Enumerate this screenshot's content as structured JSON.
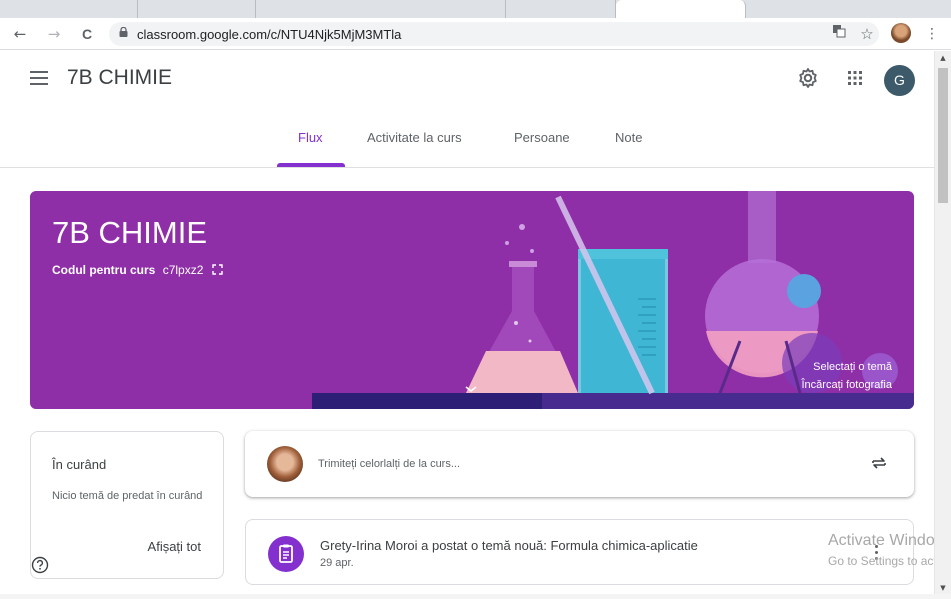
{
  "browser": {
    "url": "classroom.google.com/c/NTU4Njk5MjM3MTla",
    "nav": {
      "back": "←",
      "forward": "→",
      "reload": "C"
    }
  },
  "header": {
    "class_name": "7B CHIMIE",
    "avatar_letter": "G",
    "tabs": [
      {
        "label": "Flux"
      },
      {
        "label": "Activitate la curs"
      },
      {
        "label": "Persoane"
      },
      {
        "label": "Note"
      }
    ],
    "accent_color": "#8430ce"
  },
  "banner": {
    "title": "7B CHIMIE",
    "code_label": "Codul pentru curs",
    "code_value": "c7lpxz2",
    "select_theme": "Selectați o temă",
    "upload_photo": "Încărcați fotografia",
    "background_color": "#8f2fa8"
  },
  "upcoming": {
    "title": "În curând",
    "text": "Nicio temă de predat în curând",
    "link": "Afișați tot"
  },
  "composer": {
    "placeholder": "Trimiteți celorlalți de la curs..."
  },
  "stream": [
    {
      "title": "Grety-Irina Moroi a postat o temă nouă: Formula chimica-aplicatie",
      "date": "29 apr."
    }
  ],
  "watermark": {
    "line1": "Activate Windo",
    "line2": "Go to Settings to act"
  }
}
